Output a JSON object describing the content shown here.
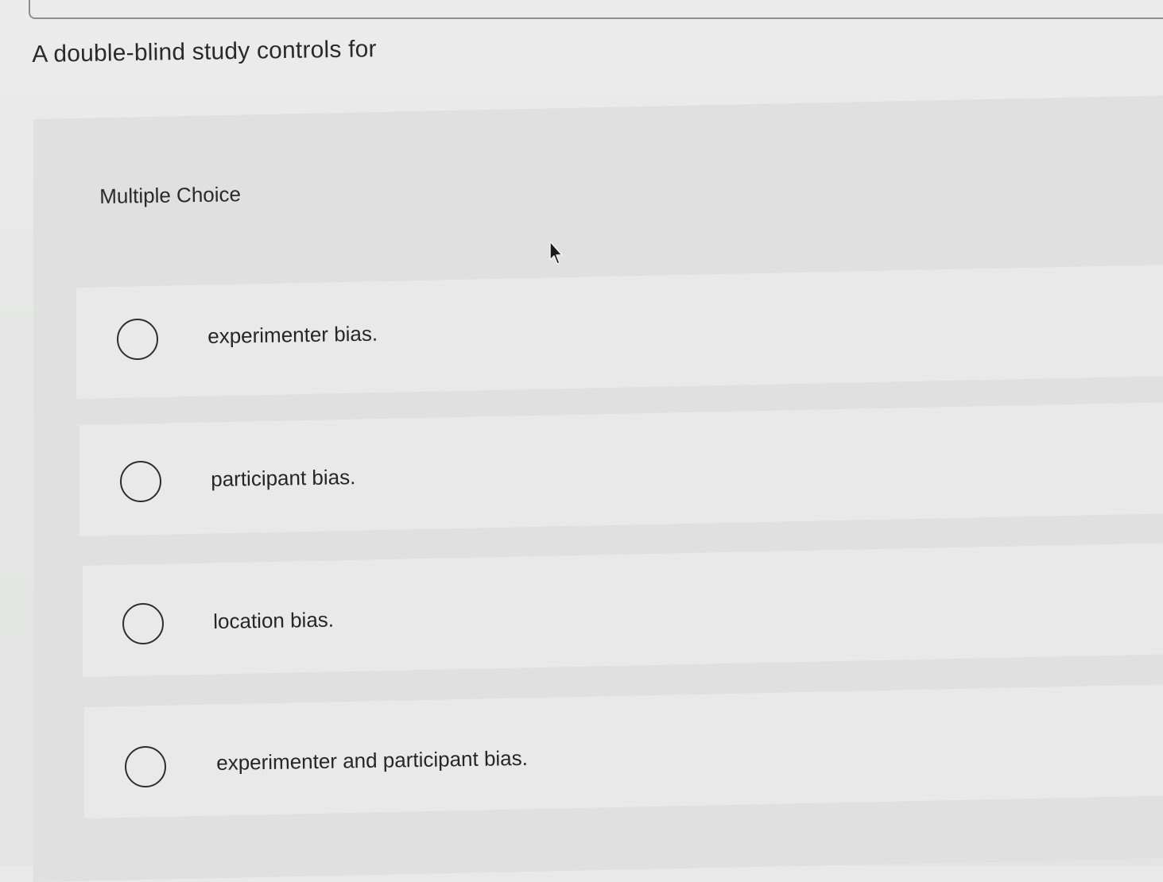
{
  "question": {
    "text": "A double-blind study controls for"
  },
  "question_type": "Multiple Choice",
  "options": [
    {
      "label": "experimenter bias.",
      "selected": false
    },
    {
      "label": "participant bias.",
      "selected": false
    },
    {
      "label": "location bias.",
      "selected": false
    },
    {
      "label": "experimenter and participant bias.",
      "selected": false
    }
  ],
  "icons": {
    "radio": "radio-unselected-icon",
    "cursor": "mouse-pointer-icon"
  }
}
